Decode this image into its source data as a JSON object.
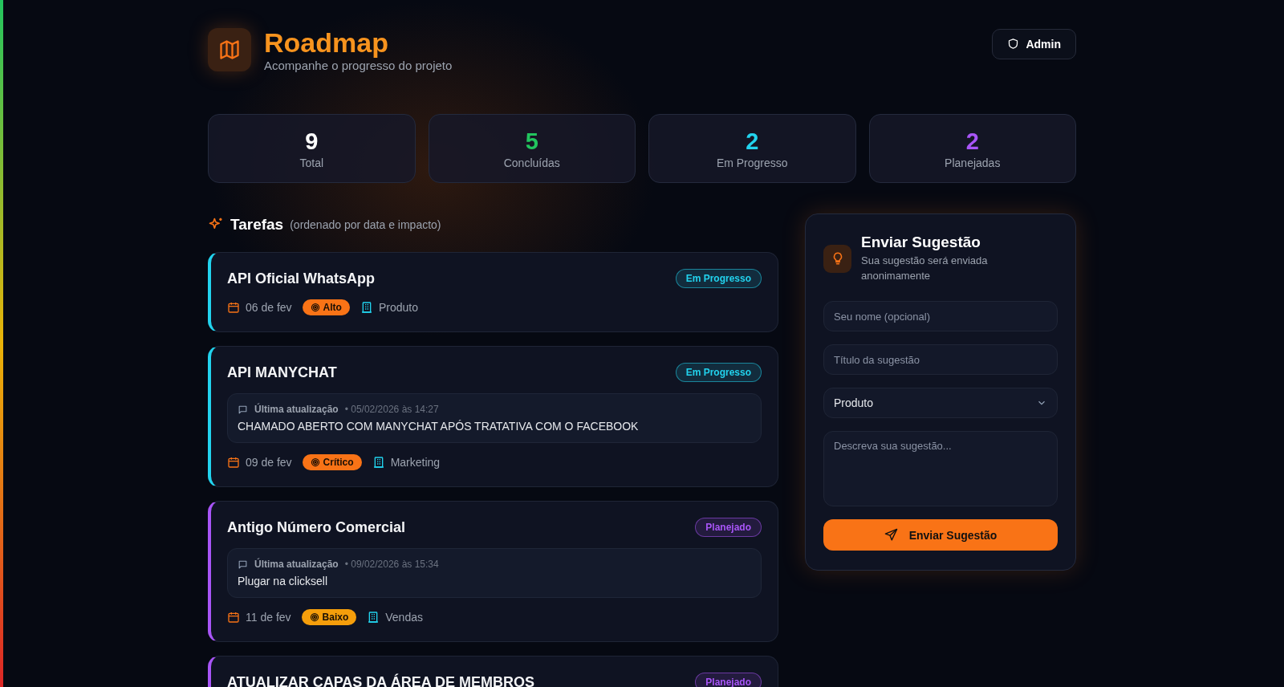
{
  "header": {
    "title": "Roadmap",
    "subtitle": "Acompanhe o progresso do projeto",
    "admin_button": "Admin"
  },
  "stats": [
    {
      "value": "9",
      "label": "Total",
      "color": "#ffffff"
    },
    {
      "value": "5",
      "label": "Concluídas",
      "color": "#22c55e"
    },
    {
      "value": "2",
      "label": "Em Progresso",
      "color": "#22d3ee"
    },
    {
      "value": "2",
      "label": "Planejadas",
      "color": "#a855f7"
    }
  ],
  "tasks_heading": {
    "title": "Tarefas",
    "note": "(ordenado por data e impacto)"
  },
  "tasks": [
    {
      "title": "API Oficial WhatsApp",
      "status": {
        "kind": "progress",
        "label": "Em Progresso"
      },
      "date": "06 de fev",
      "impact": {
        "label": "Alto",
        "color": "#f97316"
      },
      "area": "Produto"
    },
    {
      "title": "API MANYCHAT",
      "status": {
        "kind": "progress",
        "label": "Em Progresso"
      },
      "update": {
        "label": "Última atualização",
        "time": "• 05/02/2026 às 14:27",
        "text": "CHAMADO ABERTO COM MANYCHAT APÓS TRATATIVA COM O FACEBOOK"
      },
      "date": "09 de fev",
      "impact": {
        "label": "Crítico",
        "color": "#f97316"
      },
      "area": "Marketing"
    },
    {
      "title": "Antigo Número Comercial",
      "status": {
        "kind": "planned",
        "label": "Planejado"
      },
      "update": {
        "label": "Última atualização",
        "time": "• 09/02/2026 às 15:34",
        "text": "Plugar na clicksell"
      },
      "date": "11 de fev",
      "impact": {
        "label": "Baixo",
        "color": "#f59e0b"
      },
      "area": "Vendas"
    },
    {
      "title": "ATUALIZAR CAPAS DA ÁREA DE MEMBROS",
      "status": {
        "kind": "planned",
        "label": "Planejado"
      }
    }
  ],
  "suggestion": {
    "title": "Enviar Sugestão",
    "subtitle": "Sua sugestão será enviada anonimamente",
    "name_placeholder": "Seu nome (opcional)",
    "title_placeholder": "Título da sugestão",
    "category": "Produto",
    "description_placeholder": "Descreva sua sugestão...",
    "submit": "Enviar Sugestão"
  }
}
